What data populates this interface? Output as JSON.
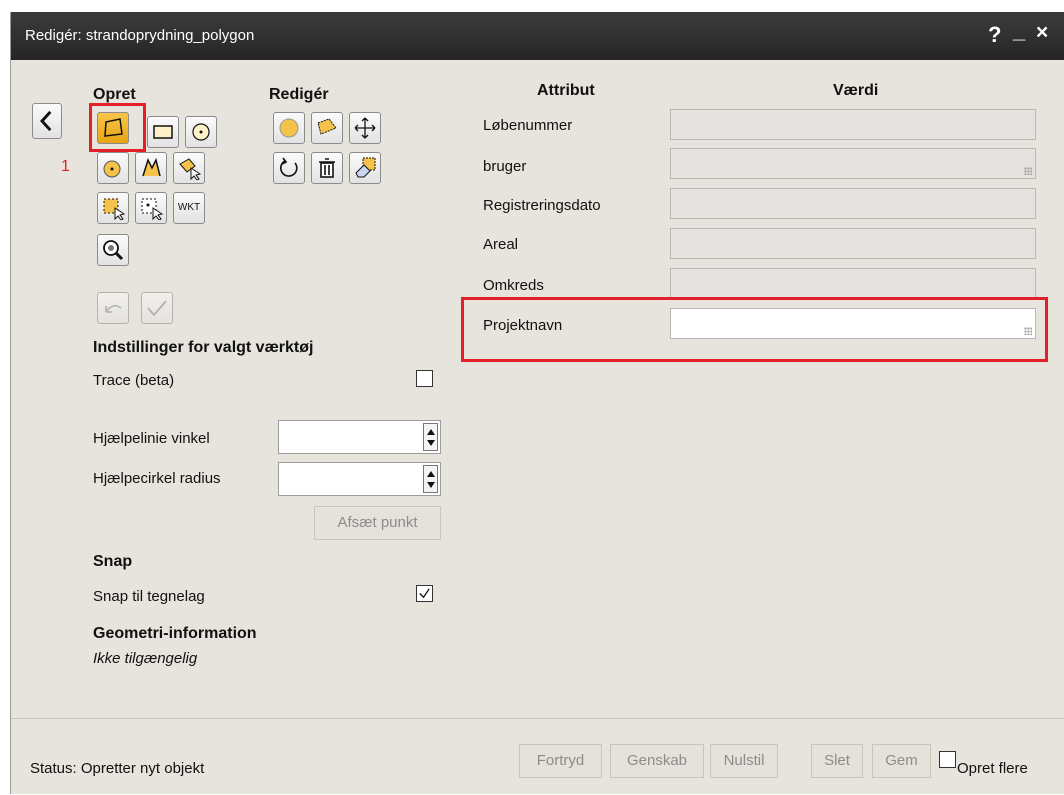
{
  "window": {
    "title": "Redigér: strandoprydning_polygon",
    "help": "?",
    "minimize": "_",
    "close": "×"
  },
  "left": {
    "back": "<",
    "create_header": "Opret",
    "edit_header": "Redigér",
    "step_marker": "1",
    "wkt": "WKT",
    "settings_header": "Indstillinger for valgt værktøj",
    "trace_label": "Trace (beta)",
    "angle_label": "Hjælpelinie vinkel",
    "radius_label": "Hjælpecirkel radius",
    "set_point": "Afsæt punkt",
    "snap_header": "Snap",
    "snap_label": "Snap til tegnelag",
    "geo_header": "Geometri-information",
    "geo_value": "Ikke tilgængelig"
  },
  "attributes": {
    "col_attr": "Attribut",
    "col_value": "Værdi",
    "rows": [
      {
        "label": "Løbenummer",
        "value": ""
      },
      {
        "label": "bruger",
        "value": ""
      },
      {
        "label": "Registreringsdato",
        "value": ""
      },
      {
        "label": "Areal",
        "value": ""
      },
      {
        "label": "Omkreds",
        "value": ""
      },
      {
        "label": "Projektnavn",
        "value": ""
      }
    ]
  },
  "status": {
    "text": "Status: Opretter nyt objekt",
    "undo": "Fortryd",
    "redo": "Genskab",
    "reset": "Nulstil",
    "delete": "Slet",
    "save": "Gem",
    "create_more": "Opret flere"
  },
  "colors": {
    "highlight": "#e2202a",
    "active_tool": "#f3b42a",
    "titlebar": "#2e2e2e"
  }
}
